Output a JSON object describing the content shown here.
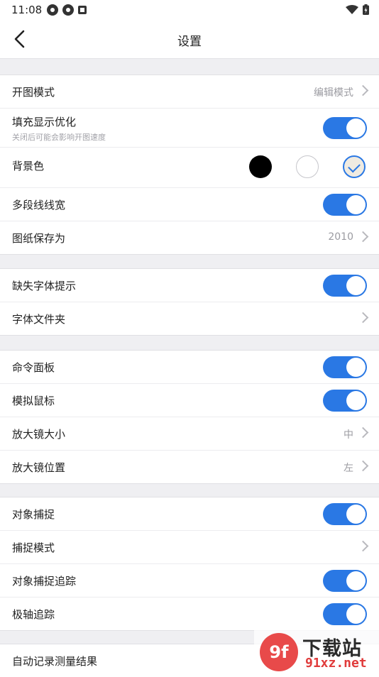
{
  "status": {
    "time": "11:08"
  },
  "header": {
    "title": "设置"
  },
  "sections": [
    {
      "rows": [
        {
          "label": "开图模式",
          "value": "编辑模式"
        },
        {
          "label": "填充显示优化",
          "sublabel": "关闭后可能会影响开图速度",
          "toggle": true
        },
        {
          "label": "背景色",
          "swatches": [
            "#000000",
            "#ffffff",
            "#f0ebe1"
          ],
          "selected": 2
        },
        {
          "label": "多段线线宽",
          "toggle": true
        },
        {
          "label": "图纸保存为",
          "value": "2010"
        }
      ]
    },
    {
      "rows": [
        {
          "label": "缺失字体提示",
          "toggle": true
        },
        {
          "label": "字体文件夹"
        }
      ]
    },
    {
      "rows": [
        {
          "label": "命令面板",
          "toggle": true
        },
        {
          "label": "模拟鼠标",
          "toggle": true
        },
        {
          "label": "放大镜大小",
          "value": "中"
        },
        {
          "label": "放大镜位置",
          "value": "左"
        }
      ]
    },
    {
      "rows": [
        {
          "label": "对象捕捉",
          "toggle": true
        },
        {
          "label": "捕捉模式"
        },
        {
          "label": "对象捕捉追踪",
          "toggle": true
        },
        {
          "label": "极轴追踪",
          "toggle": true
        }
      ]
    },
    {
      "rows": [
        {
          "label": "自动记录测量结果"
        }
      ]
    }
  ],
  "watermark": {
    "logo": "9f",
    "top": "下载站",
    "bottom": "91xz.net"
  },
  "colors": {
    "accent": "#2a78e4",
    "background": "#efeff2"
  }
}
